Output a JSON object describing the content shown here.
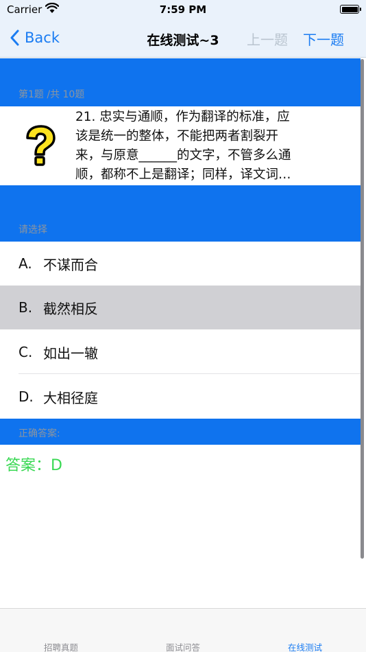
{
  "status_bar": {
    "carrier": "Carrier",
    "time": "7:59 PM"
  },
  "nav": {
    "back_label": "Back",
    "title": "在线测试~3",
    "prev_label": "上一题",
    "next_label": "下一题"
  },
  "question": {
    "progress_label": "第1题 /共 10题",
    "icon": "question-mark-icon",
    "lines": [
      "21. 忠实与通顺，作为翻译的标准，应",
      "该是统一的整体，不能把两者割裂开",
      "来，与原意______的文字，不管多么通",
      "顺，都称不上是翻译；同样，译文词…"
    ]
  },
  "choices": {
    "section_label": "请选择",
    "options": [
      {
        "letter": "A.",
        "text": "不谋而合",
        "selected": false
      },
      {
        "letter": "B.",
        "text": "截然相反",
        "selected": true
      },
      {
        "letter": "C.",
        "text": "如出一辙",
        "selected": false
      },
      {
        "letter": "D.",
        "text": "大相径庭",
        "selected": false
      }
    ]
  },
  "answer": {
    "section_label": "正确答案:",
    "text": "答案：D"
  },
  "tab_bar": {
    "tabs": [
      {
        "label": "招聘真题",
        "active": false
      },
      {
        "label": "面试问答",
        "active": false
      },
      {
        "label": "在线测试",
        "active": true
      }
    ]
  },
  "colors": {
    "accent": "#1a7cf2",
    "section_band": "#0f73ee",
    "answer_green": "#39d853",
    "selected_row": "#d0d0d4"
  }
}
